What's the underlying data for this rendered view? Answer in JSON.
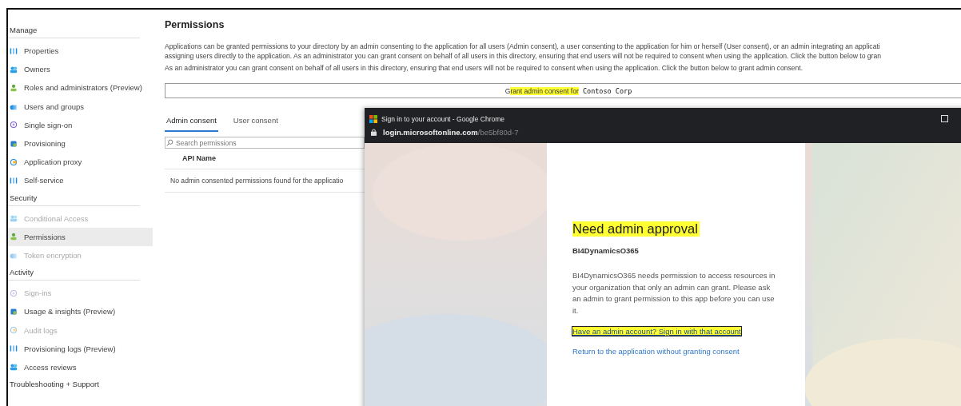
{
  "sidebar": {
    "sections": [
      {
        "title": "Manage",
        "items": [
          {
            "label": "Properties",
            "disabled": false,
            "selected": false
          },
          {
            "label": "Owners",
            "disabled": false,
            "selected": false
          },
          {
            "label": "Roles and administrators (Preview)",
            "disabled": false,
            "selected": false
          },
          {
            "label": "Users and groups",
            "disabled": false,
            "selected": false
          },
          {
            "label": "Single sign-on",
            "disabled": false,
            "selected": false
          },
          {
            "label": "Provisioning",
            "disabled": false,
            "selected": false
          },
          {
            "label": "Application proxy",
            "disabled": false,
            "selected": false
          },
          {
            "label": "Self-service",
            "disabled": false,
            "selected": false
          }
        ]
      },
      {
        "title": "Security",
        "items": [
          {
            "label": "Conditional Access",
            "disabled": true,
            "selected": false
          },
          {
            "label": "Permissions",
            "disabled": false,
            "selected": true
          },
          {
            "label": "Token encryption",
            "disabled": true,
            "selected": false
          }
        ]
      },
      {
        "title": "Activity",
        "items": [
          {
            "label": "Sign-ins",
            "disabled": true,
            "selected": false
          },
          {
            "label": "Usage & insights (Preview)",
            "disabled": false,
            "selected": false
          },
          {
            "label": "Audit logs",
            "disabled": true,
            "selected": false
          },
          {
            "label": "Provisioning logs (Preview)",
            "disabled": false,
            "selected": false
          },
          {
            "label": "Access reviews",
            "disabled": false,
            "selected": false
          }
        ]
      },
      {
        "title": "Troubleshooting + Support"
      }
    ]
  },
  "main": {
    "title": "Permissions",
    "intro_lines": [
      "Applications can be granted permissions to your directory by an admin consenting to the application for all users (Admin consent), a user consenting to the application for him or herself (User consent), or an admin integrating an applicati",
      "assigning users directly to the application. As an administrator you can grant consent on behalf of all users in this directory, ensuring that end users will not be required to consent when using the application. Click the button below to gran"
    ],
    "note": "As an administrator you can grant consent on behalf of all users in this directory, ensuring that end users will not be required to consent when using the application. Click the button below to grant admin consent.",
    "grant_button": {
      "prefix": "G",
      "label": "rant admin consent for",
      "highlighted": true,
      "org": "Contoso Corp"
    },
    "tabs": [
      {
        "label": "Admin consent",
        "selected": true
      },
      {
        "label": "User consent",
        "selected": false
      }
    ],
    "search": {
      "placeholder": "Search permissions"
    },
    "table": {
      "columns": [
        "API Name"
      ],
      "empty_message": "No admin consented permissions found for the applicatio"
    }
  },
  "popup": {
    "title": "Sign in to your account - Google Chrome",
    "url_host": "login.microsoftonline.com",
    "url_path": "/be5bf80d-7",
    "heading": "Need admin approval",
    "heading_highlighted": true,
    "app_name": "BI4DynamicsO365",
    "message": "BI4DynamicsO365 needs permission to access resources in your organization that only an admin can grant. Please ask an admin to grant permission to this app before you can use it.",
    "links": [
      {
        "label": "Have an admin account? Sign in with that account",
        "highlighted": true,
        "focused": true
      },
      {
        "label": "Return to the application without granting consent",
        "highlighted": false,
        "focused": false
      }
    ]
  }
}
